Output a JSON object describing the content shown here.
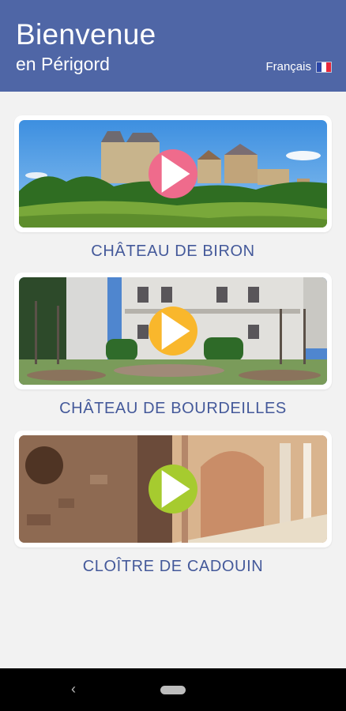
{
  "header": {
    "title": "Bienvenue",
    "subtitle": "en Périgord",
    "language": "Français",
    "background": "#4f66a6"
  },
  "cards": [
    {
      "name": "CHÂTEAU DE BIRON",
      "play_color": "#ef6b8c",
      "icon": "play-icon"
    },
    {
      "name": "CHÂTEAU DE BOURDEILLES",
      "play_color": "#f9b72c",
      "icon": "play-icon"
    },
    {
      "name": "CLOÎTRE DE CADOUIN",
      "play_color": "#a6cb2f",
      "icon": "play-icon"
    }
  ],
  "navbar": {
    "back_icon": "back-icon",
    "back_glyph": "‹",
    "home_icon": "home-pill-icon"
  }
}
